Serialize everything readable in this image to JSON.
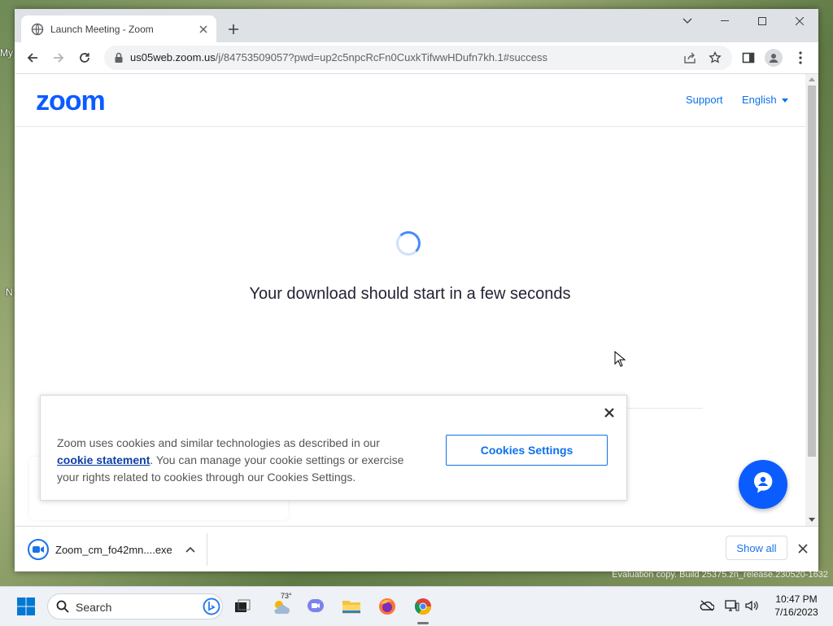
{
  "desktop": {
    "left_text_1": "My",
    "left_text_2": "N",
    "watermark": "Evaluation copy. Build 25375.zn_release.230520-1632"
  },
  "browser": {
    "tab_title": "Launch Meeting - Zoom",
    "url_host": "us05web.zoom.us",
    "url_path": "/j/84753509057?pwd=up2c5npcRcFn0CuxkTifwwHDufn7kh.1#success"
  },
  "zoom_page": {
    "logo": "zoom",
    "support_label": "Support",
    "language_label": "English",
    "download_message": "Your download should start in a few seconds"
  },
  "cookie_banner": {
    "text_before": "Zoom uses cookies and similar technologies as described in our ",
    "link_text": "cookie statement",
    "text_after": ". You can manage your cookie settings or exercise your rights related to cookies through our Cookies Settings.",
    "button_label": "Cookies Settings"
  },
  "download_bar": {
    "filename": "Zoom_cm_fo42mn....exe",
    "show_all_label": "Show all"
  },
  "taskbar": {
    "search_label": "Search",
    "weather_temp": "73°",
    "time": "10:47 PM",
    "date": "7/16/2023"
  },
  "colors": {
    "zoom_blue": "#0b5cff",
    "link_blue": "#0e71eb",
    "chrome_blue": "#1a73e8"
  }
}
